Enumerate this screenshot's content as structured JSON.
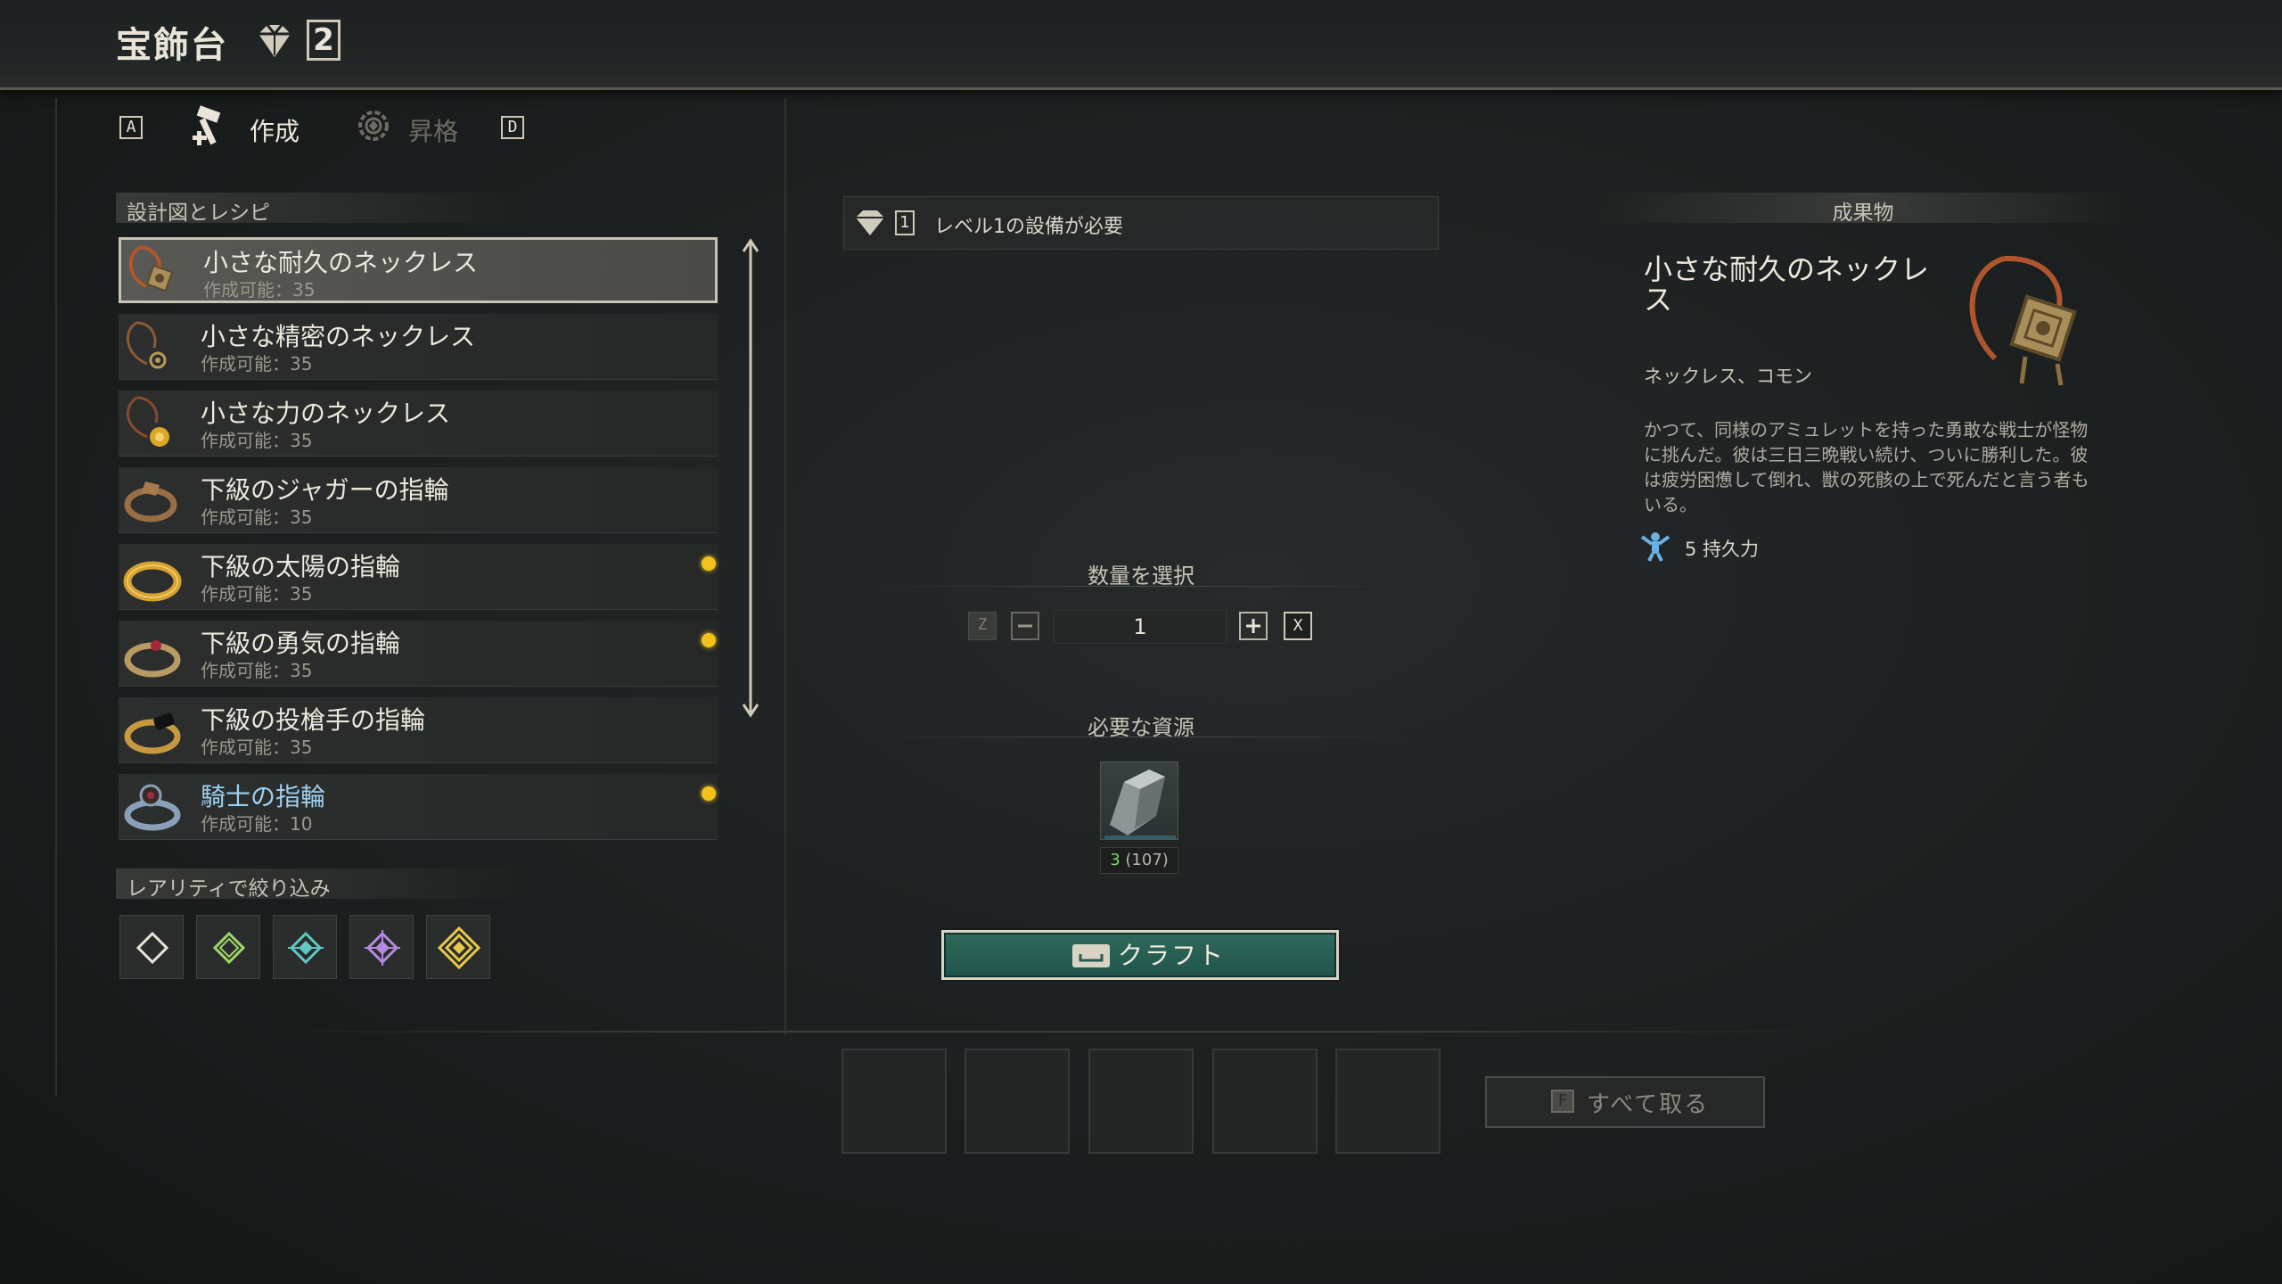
{
  "header": {
    "title": "宝飾台",
    "level": "2"
  },
  "tabs": {
    "prev_key": "A",
    "next_key": "D",
    "items": [
      {
        "label": "作成",
        "active": true,
        "icon": "hammer-icon"
      },
      {
        "label": "昇格",
        "active": false,
        "icon": "ascend-gear-icon"
      }
    ]
  },
  "recipes": {
    "heading": "設計図とレシピ",
    "items": [
      {
        "name": "小さな耐久のネックレス",
        "sub": "作成可能：35",
        "selected": true,
        "dot": false,
        "icon": "necklace-icon"
      },
      {
        "name": "小さな精密のネックレス",
        "sub": "作成可能：35",
        "selected": false,
        "dot": false,
        "icon": "necklace-icon"
      },
      {
        "name": "小さな力のネックレス",
        "sub": "作成可能：35",
        "selected": false,
        "dot": false,
        "icon": "necklace-icon"
      },
      {
        "name": "下級のジャガーの指輪",
        "sub": "作成可能：35",
        "selected": false,
        "dot": false,
        "icon": "ring-icon"
      },
      {
        "name": "下級の太陽の指輪",
        "sub": "作成可能：35",
        "selected": false,
        "dot": true,
        "icon": "ring-icon"
      },
      {
        "name": "下級の勇気の指輪",
        "sub": "作成可能：35",
        "selected": false,
        "dot": true,
        "icon": "ring-icon"
      },
      {
        "name": "下級の投槍手の指輪",
        "sub": "作成可能：35",
        "selected": false,
        "dot": false,
        "icon": "ring-icon"
      },
      {
        "name": "騎士の指輪",
        "sub": "作成可能：10",
        "selected": false,
        "dot": true,
        "icon": "ring-icon"
      }
    ]
  },
  "rarity": {
    "heading": "レアリティで絞り込み",
    "filters": [
      {
        "name": "common",
        "color": "#e8e4d8"
      },
      {
        "name": "uncommon",
        "color": "#9ed86a"
      },
      {
        "name": "rare",
        "color": "#5fc8c0"
      },
      {
        "name": "epic",
        "color": "#b48ae0"
      },
      {
        "name": "legendary",
        "color": "#e8c84a"
      }
    ]
  },
  "requirement": {
    "level": "1",
    "text": "レベル1の設備が必要"
  },
  "quantity": {
    "heading": "数量を選択",
    "value": "1",
    "dec_key": "Z",
    "inc_key": "X"
  },
  "resources": {
    "heading": "必要な資源",
    "count": "3",
    "owned": "(107)",
    "icon": "iron-ingot-icon"
  },
  "craft": {
    "label": "クラフト"
  },
  "output": {
    "take_all_key": "F",
    "take_all_label": "すべて取る",
    "slots": 5
  },
  "detail": {
    "heading": "成果物",
    "name": "小さな耐久のネックレス",
    "type": "ネックレス、コモン",
    "description": "かつて、同様のアミュレットを持った勇敢な戦士が怪物に挑んだ。彼は三日三晩戦い続け、ついに勝利した。彼は疲労困憊して倒れ、獣の死骸の上で死んだと言う者もいる。",
    "stat": "5 持久力",
    "stat_icon": "endurance-icon"
  },
  "colors": {
    "accent_green": "#2f6a5c",
    "notify_yellow": "#f2c21a",
    "stat_blue": "#6ab0e0"
  }
}
